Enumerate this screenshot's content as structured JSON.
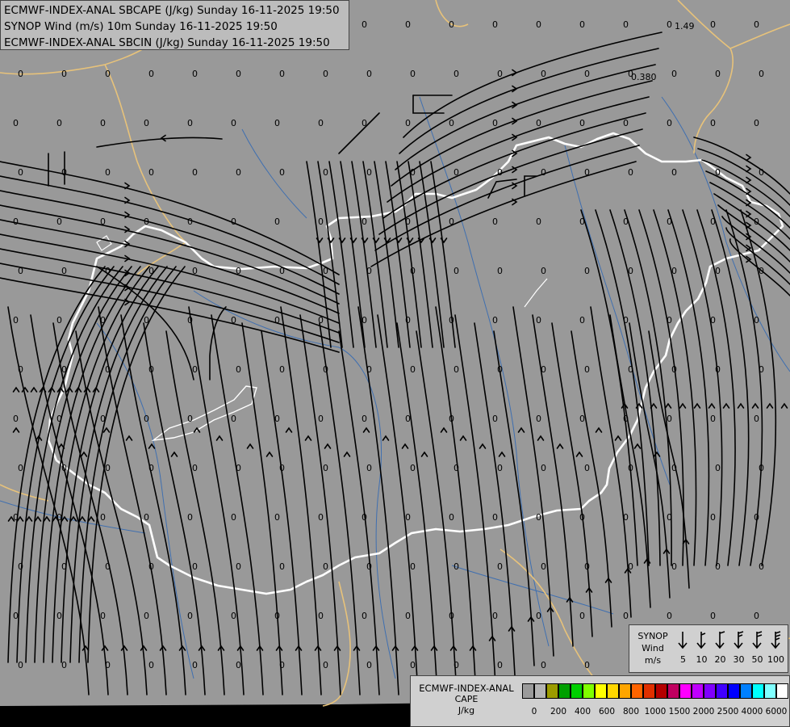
{
  "titles": {
    "line1": "ECMWF-INDEX-ANAL SBCAPE (J/kg) Sunday 16-11-2025 19:50",
    "line2": "SYNOP Wind (m/s) 10m Sunday 16-11-2025 19:50",
    "line3": "ECMWF-INDEX-ANAL SBCIN (J/kg) Sunday 16-11-2025 19:50"
  },
  "map": {
    "background_color": "#999999",
    "border_color": "#ffffff",
    "neighbour_border_color": "#e7c27a",
    "river_color": "#3f6fb0",
    "streamline_color": "#000000",
    "special_values": [
      "1.49",
      "0.380"
    ]
  },
  "synop_legend": {
    "label_line1": "SYNOP",
    "label_line2": "Wind",
    "label_line3": "m/s",
    "speeds": [
      "5",
      "10",
      "20",
      "30",
      "50",
      "100"
    ]
  },
  "cape_legend": {
    "label_line1": "ECMWF-INDEX-ANAL",
    "label_line2": "CAPE",
    "label_line3": "J/kg",
    "ticks": [
      "0",
      "200",
      "400",
      "600",
      "800",
      "1000",
      "1500",
      "2000",
      "2500",
      "4000",
      "6000"
    ],
    "colors": [
      "#9a9a9a",
      "#b4b4b4",
      "#9c9c00",
      "#00a000",
      "#00d000",
      "#80ff00",
      "#ffff00",
      "#ffd700",
      "#ffa500",
      "#ff6400",
      "#e03000",
      "#b40000",
      "#c00060",
      "#ff00ff",
      "#c000ff",
      "#8000ff",
      "#4000ff",
      "#0000ff",
      "#0080ff",
      "#00ffff",
      "#80ffff",
      "#ffffff"
    ]
  }
}
